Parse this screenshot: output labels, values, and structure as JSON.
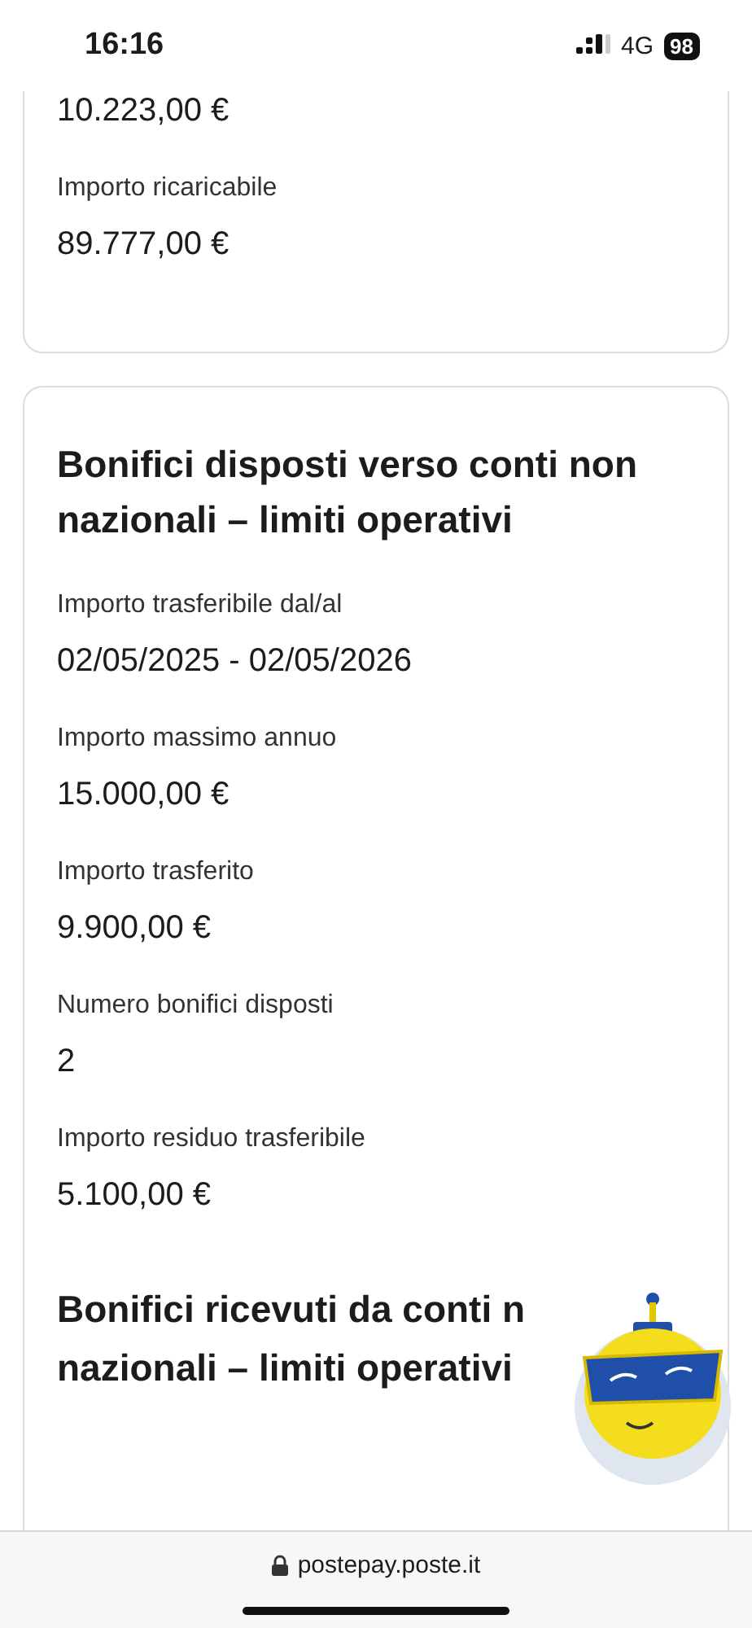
{
  "status_bar": {
    "time": "16:16",
    "network": "4G",
    "battery": "98"
  },
  "limits_card": {
    "items": [
      {
        "value": "10.223,00 €"
      },
      {
        "label": "Importo ricaricabile",
        "value": "89.777,00 €"
      }
    ]
  },
  "foreign_transfers_card": {
    "title": "Bonifici disposti verso conti non nazionali – limiti operativi",
    "items": [
      {
        "label": "Importo trasferibile dal/al",
        "value": "02/05/2025 - 02/05/2026"
      },
      {
        "label": "Importo massimo annuo",
        "value": "15.000,00 €"
      },
      {
        "label": "Importo trasferito",
        "value": "9.900,00 €"
      },
      {
        "label": "Numero bonifici disposti",
        "value": "2"
      },
      {
        "label": "Importo residuo trasferibile",
        "value": "5.100,00 €"
      }
    ],
    "next_title_lines": [
      "Bonifici ricevuti da conti n",
      "nazionali – limiti operativi"
    ]
  },
  "address_bar": {
    "url": "postepay.poste.it"
  }
}
